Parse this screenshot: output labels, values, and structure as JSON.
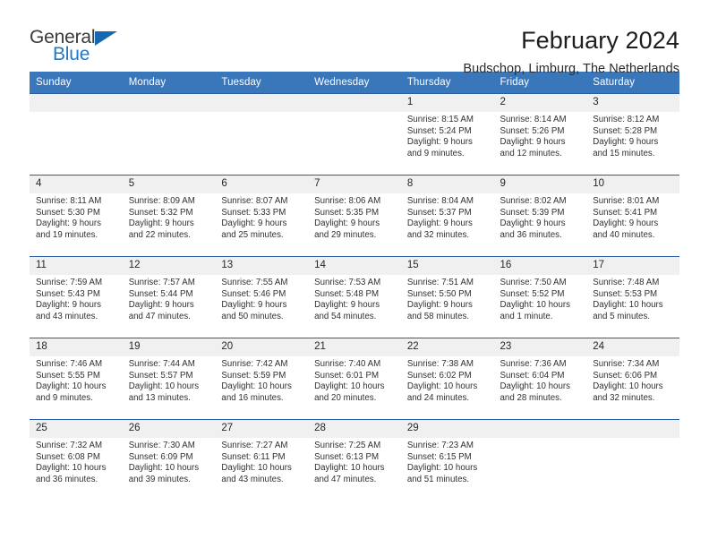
{
  "brand": {
    "name_part1": "General",
    "name_part2": "Blue",
    "logo_icon": "blue-triangle-icon"
  },
  "header": {
    "title": "February 2024",
    "subtitle": "Budschop, Limburg, The Netherlands"
  },
  "calendar": {
    "weekday_headers": [
      "Sunday",
      "Monday",
      "Tuesday",
      "Wednesday",
      "Thursday",
      "Friday",
      "Saturday"
    ],
    "header_bg_color": "#3a76ba",
    "grid_line_color": "#2b5e9e",
    "daynum_bg_color": "#f0f0f0",
    "weeks": [
      [
        {
          "day": "",
          "empty": true
        },
        {
          "day": "",
          "empty": true
        },
        {
          "day": "",
          "empty": true
        },
        {
          "day": "",
          "empty": true
        },
        {
          "day": "1",
          "sunrise": "Sunrise: 8:15 AM",
          "sunset": "Sunset: 5:24 PM",
          "daylight": "Daylight: 9 hours and 9 minutes."
        },
        {
          "day": "2",
          "sunrise": "Sunrise: 8:14 AM",
          "sunset": "Sunset: 5:26 PM",
          "daylight": "Daylight: 9 hours and 12 minutes."
        },
        {
          "day": "3",
          "sunrise": "Sunrise: 8:12 AM",
          "sunset": "Sunset: 5:28 PM",
          "daylight": "Daylight: 9 hours and 15 minutes."
        }
      ],
      [
        {
          "day": "4",
          "sunrise": "Sunrise: 8:11 AM",
          "sunset": "Sunset: 5:30 PM",
          "daylight": "Daylight: 9 hours and 19 minutes."
        },
        {
          "day": "5",
          "sunrise": "Sunrise: 8:09 AM",
          "sunset": "Sunset: 5:32 PM",
          "daylight": "Daylight: 9 hours and 22 minutes."
        },
        {
          "day": "6",
          "sunrise": "Sunrise: 8:07 AM",
          "sunset": "Sunset: 5:33 PM",
          "daylight": "Daylight: 9 hours and 25 minutes."
        },
        {
          "day": "7",
          "sunrise": "Sunrise: 8:06 AM",
          "sunset": "Sunset: 5:35 PM",
          "daylight": "Daylight: 9 hours and 29 minutes."
        },
        {
          "day": "8",
          "sunrise": "Sunrise: 8:04 AM",
          "sunset": "Sunset: 5:37 PM",
          "daylight": "Daylight: 9 hours and 32 minutes."
        },
        {
          "day": "9",
          "sunrise": "Sunrise: 8:02 AM",
          "sunset": "Sunset: 5:39 PM",
          "daylight": "Daylight: 9 hours and 36 minutes."
        },
        {
          "day": "10",
          "sunrise": "Sunrise: 8:01 AM",
          "sunset": "Sunset: 5:41 PM",
          "daylight": "Daylight: 9 hours and 40 minutes."
        }
      ],
      [
        {
          "day": "11",
          "sunrise": "Sunrise: 7:59 AM",
          "sunset": "Sunset: 5:43 PM",
          "daylight": "Daylight: 9 hours and 43 minutes."
        },
        {
          "day": "12",
          "sunrise": "Sunrise: 7:57 AM",
          "sunset": "Sunset: 5:44 PM",
          "daylight": "Daylight: 9 hours and 47 minutes."
        },
        {
          "day": "13",
          "sunrise": "Sunrise: 7:55 AM",
          "sunset": "Sunset: 5:46 PM",
          "daylight": "Daylight: 9 hours and 50 minutes."
        },
        {
          "day": "14",
          "sunrise": "Sunrise: 7:53 AM",
          "sunset": "Sunset: 5:48 PM",
          "daylight": "Daylight: 9 hours and 54 minutes."
        },
        {
          "day": "15",
          "sunrise": "Sunrise: 7:51 AM",
          "sunset": "Sunset: 5:50 PM",
          "daylight": "Daylight: 9 hours and 58 minutes."
        },
        {
          "day": "16",
          "sunrise": "Sunrise: 7:50 AM",
          "sunset": "Sunset: 5:52 PM",
          "daylight": "Daylight: 10 hours and 1 minute."
        },
        {
          "day": "17",
          "sunrise": "Sunrise: 7:48 AM",
          "sunset": "Sunset: 5:53 PM",
          "daylight": "Daylight: 10 hours and 5 minutes."
        }
      ],
      [
        {
          "day": "18",
          "sunrise": "Sunrise: 7:46 AM",
          "sunset": "Sunset: 5:55 PM",
          "daylight": "Daylight: 10 hours and 9 minutes."
        },
        {
          "day": "19",
          "sunrise": "Sunrise: 7:44 AM",
          "sunset": "Sunset: 5:57 PM",
          "daylight": "Daylight: 10 hours and 13 minutes."
        },
        {
          "day": "20",
          "sunrise": "Sunrise: 7:42 AM",
          "sunset": "Sunset: 5:59 PM",
          "daylight": "Daylight: 10 hours and 16 minutes."
        },
        {
          "day": "21",
          "sunrise": "Sunrise: 7:40 AM",
          "sunset": "Sunset: 6:01 PM",
          "daylight": "Daylight: 10 hours and 20 minutes."
        },
        {
          "day": "22",
          "sunrise": "Sunrise: 7:38 AM",
          "sunset": "Sunset: 6:02 PM",
          "daylight": "Daylight: 10 hours and 24 minutes."
        },
        {
          "day": "23",
          "sunrise": "Sunrise: 7:36 AM",
          "sunset": "Sunset: 6:04 PM",
          "daylight": "Daylight: 10 hours and 28 minutes."
        },
        {
          "day": "24",
          "sunrise": "Sunrise: 7:34 AM",
          "sunset": "Sunset: 6:06 PM",
          "daylight": "Daylight: 10 hours and 32 minutes."
        }
      ],
      [
        {
          "day": "25",
          "sunrise": "Sunrise: 7:32 AM",
          "sunset": "Sunset: 6:08 PM",
          "daylight": "Daylight: 10 hours and 36 minutes."
        },
        {
          "day": "26",
          "sunrise": "Sunrise: 7:30 AM",
          "sunset": "Sunset: 6:09 PM",
          "daylight": "Daylight: 10 hours and 39 minutes."
        },
        {
          "day": "27",
          "sunrise": "Sunrise: 7:27 AM",
          "sunset": "Sunset: 6:11 PM",
          "daylight": "Daylight: 10 hours and 43 minutes."
        },
        {
          "day": "28",
          "sunrise": "Sunrise: 7:25 AM",
          "sunset": "Sunset: 6:13 PM",
          "daylight": "Daylight: 10 hours and 47 minutes."
        },
        {
          "day": "29",
          "sunrise": "Sunrise: 7:23 AM",
          "sunset": "Sunset: 6:15 PM",
          "daylight": "Daylight: 10 hours and 51 minutes."
        },
        {
          "day": "",
          "empty": true
        },
        {
          "day": "",
          "empty": true
        }
      ]
    ]
  }
}
